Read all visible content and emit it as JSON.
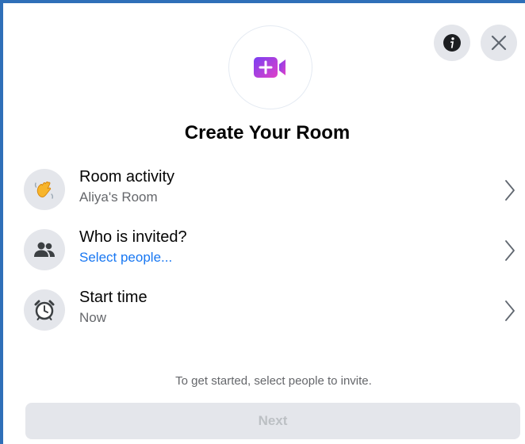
{
  "header": {
    "info_icon": "info-icon",
    "close_icon": "close-icon"
  },
  "room_icon": "video-camera-plus-icon",
  "title": "Create Your Room",
  "rows": [
    {
      "label": "Room activity",
      "sub": "Aliya's Room",
      "icon": "waving-hand-icon"
    },
    {
      "label": "Who is invited?",
      "sub": "Select people...",
      "icon": "people-icon"
    },
    {
      "label": "Start time",
      "sub": "Now",
      "icon": "alarm-clock-icon"
    }
  ],
  "hint": "To get started, select people to invite.",
  "next_label": "Next",
  "colors": {
    "frame_border": "#2f6fb8",
    "link": "#1877f2",
    "button_bg": "#e4e6eb",
    "disabled_text": "#bcc0c4",
    "secondary_text": "#65676b"
  }
}
